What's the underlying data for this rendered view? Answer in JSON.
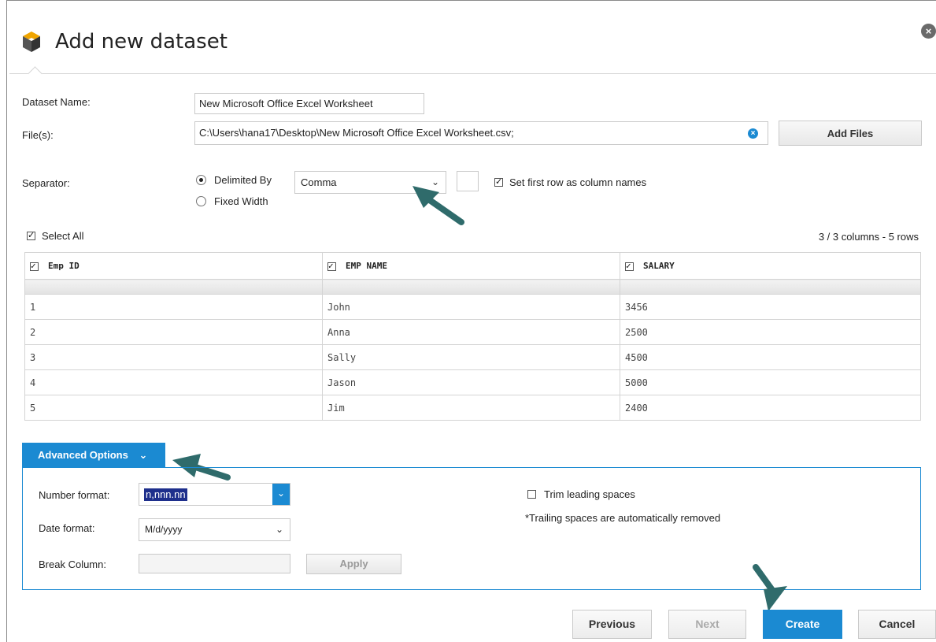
{
  "dialog": {
    "title": "Add new dataset",
    "close_label": "×"
  },
  "form": {
    "dataset_name_label": "Dataset Name:",
    "dataset_name_value": "New Microsoft Office Excel Worksheet",
    "files_label": "File(s):",
    "files_value": "C:\\Users\\hana17\\Desktop\\New Microsoft Office Excel Worksheet.csv;",
    "add_files_label": "Add Files",
    "separator_label": "Separator:",
    "delimited_by_label": "Delimited By",
    "fixed_width_label": "Fixed Width",
    "delimiter_value": "Comma",
    "first_row_label": "Set first row as column names"
  },
  "preview": {
    "select_all_label": "Select All",
    "summary": "3 / 3 columns - 5 rows",
    "columns": [
      "Emp ID",
      "EMP NAME",
      "SALARY"
    ],
    "rows": [
      [
        "1",
        "John",
        "3456"
      ],
      [
        "2",
        "Anna",
        "2500"
      ],
      [
        "3",
        "Sally",
        "4500"
      ],
      [
        "4",
        "Jason",
        "5000"
      ],
      [
        "5",
        "Jim",
        "2400"
      ]
    ]
  },
  "advanced": {
    "tab_label": "Advanced Options",
    "number_format_label": "Number format:",
    "number_format_value": "n,nnn.nn",
    "date_format_label": "Date format:",
    "date_format_value": "M/d/yyyy",
    "break_column_label": "Break Column:",
    "apply_label": "Apply",
    "trim_label": "Trim leading spaces",
    "trailing_note": "*Trailing spaces are automatically removed"
  },
  "footer": {
    "previous_label": "Previous",
    "next_label": "Next",
    "create_label": "Create",
    "cancel_label": "Cancel"
  },
  "colors": {
    "accent": "#1b8ad2",
    "arrow": "#2f6b6b"
  }
}
